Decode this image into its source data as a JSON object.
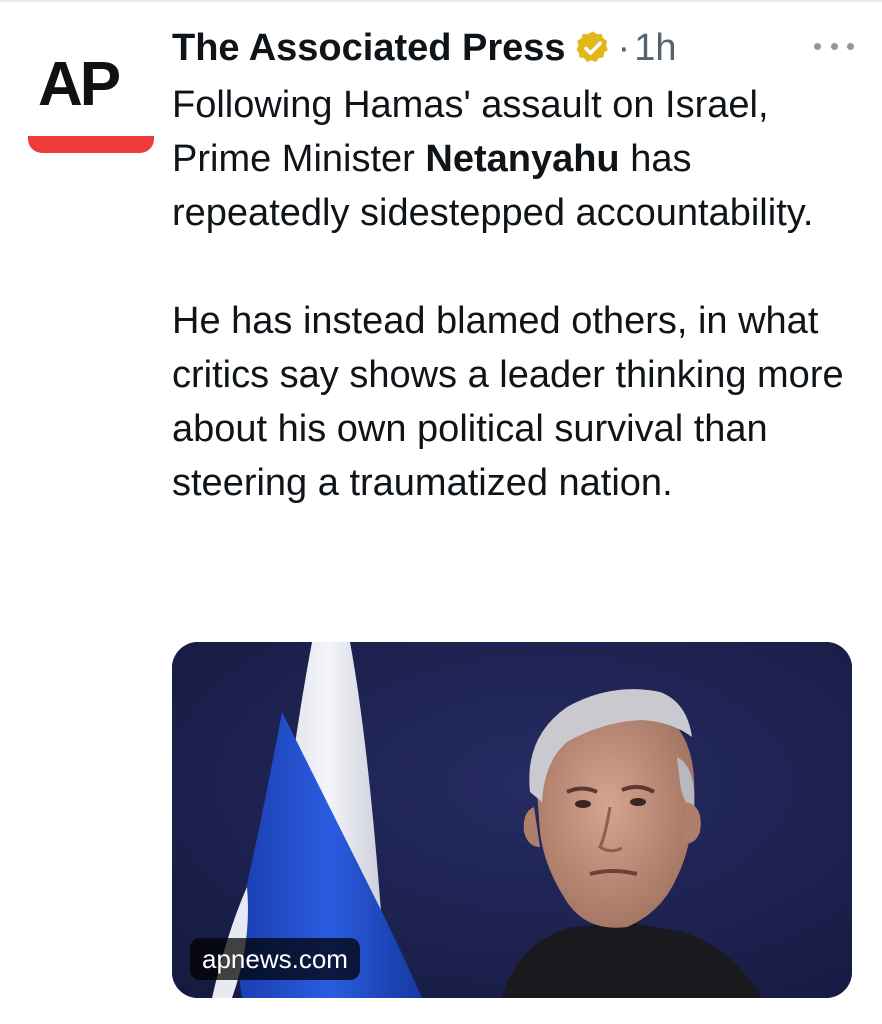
{
  "post": {
    "author": {
      "name": "The Associated Press",
      "avatar_text": "AP",
      "verified": true,
      "timestamp": "1h",
      "separator": "·"
    },
    "text": {
      "para1_before": "Following Hamas' assault on Israel, Prime Minister ",
      "para1_mention": "Netanyahu",
      "para1_after": " has repeatedly sidestepped accountability.",
      "para2": "He has instead blamed others, in what critics say shows a leader thinking more about his own political survival than steering a traumatized nation."
    },
    "link_card": {
      "domain": "apnews.com"
    },
    "icons": {
      "verified": "verified-badge-icon",
      "more": "more-options-icon"
    },
    "colors": {
      "accent_red": "#ee3a3a",
      "verified_gold": "#e2b719",
      "muted_text": "#536471",
      "photo_background": "#1c2150",
      "flag_blue": "#1f4fd1"
    }
  }
}
